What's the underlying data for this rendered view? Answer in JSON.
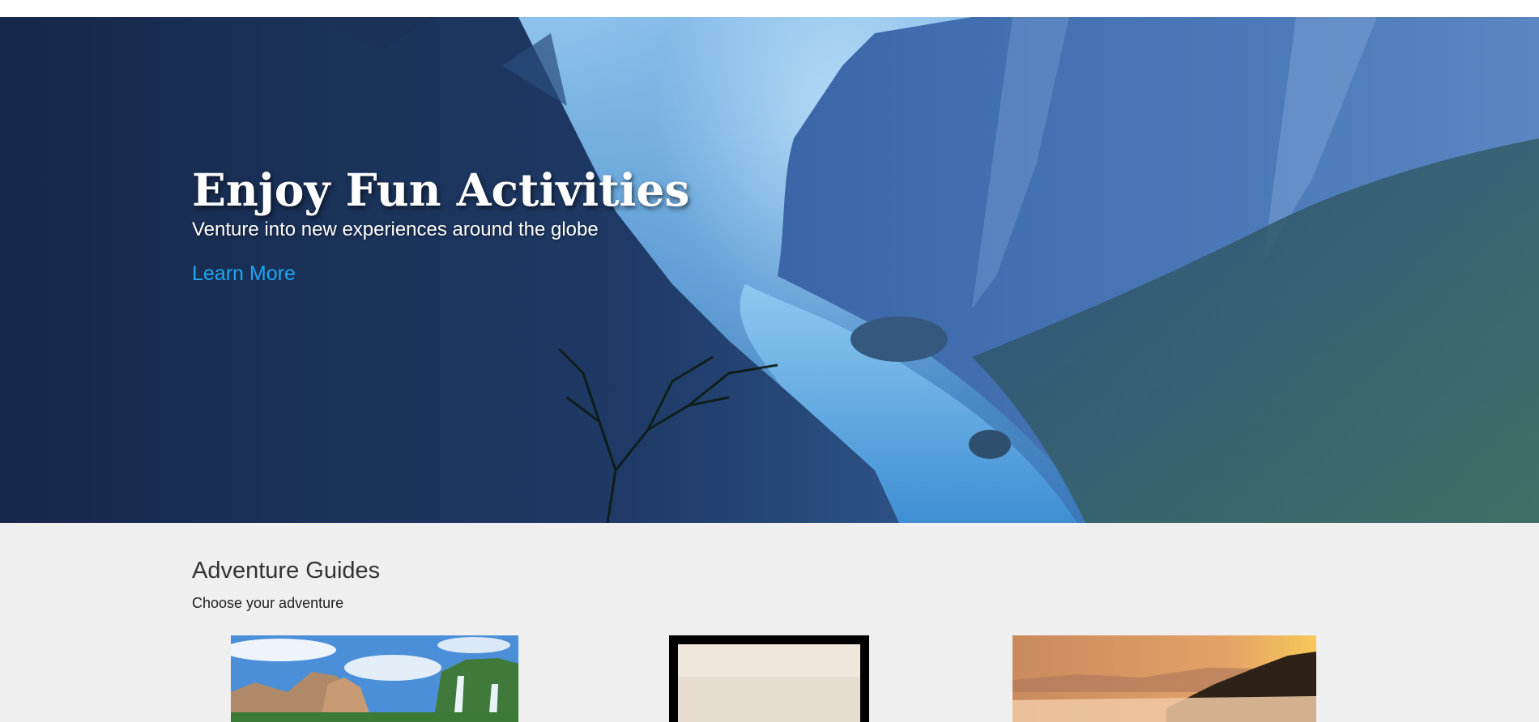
{
  "hero": {
    "title": "Enjoy Fun Activities",
    "subtitle": "Venture into new experiences around the globe",
    "cta_label": "Learn More",
    "cta_color": "#1ea7f2"
  },
  "guides": {
    "title": "Adventure Guides",
    "subtitle": "Choose your adventure",
    "cards": [
      {
        "image": "waterfall-cliffs-photo"
      },
      {
        "image": "vintage-framed-photo"
      },
      {
        "image": "misty-sunset-hills-photo"
      }
    ]
  },
  "colors": {
    "page_background": "#efefef",
    "heading_text": "#333333"
  }
}
